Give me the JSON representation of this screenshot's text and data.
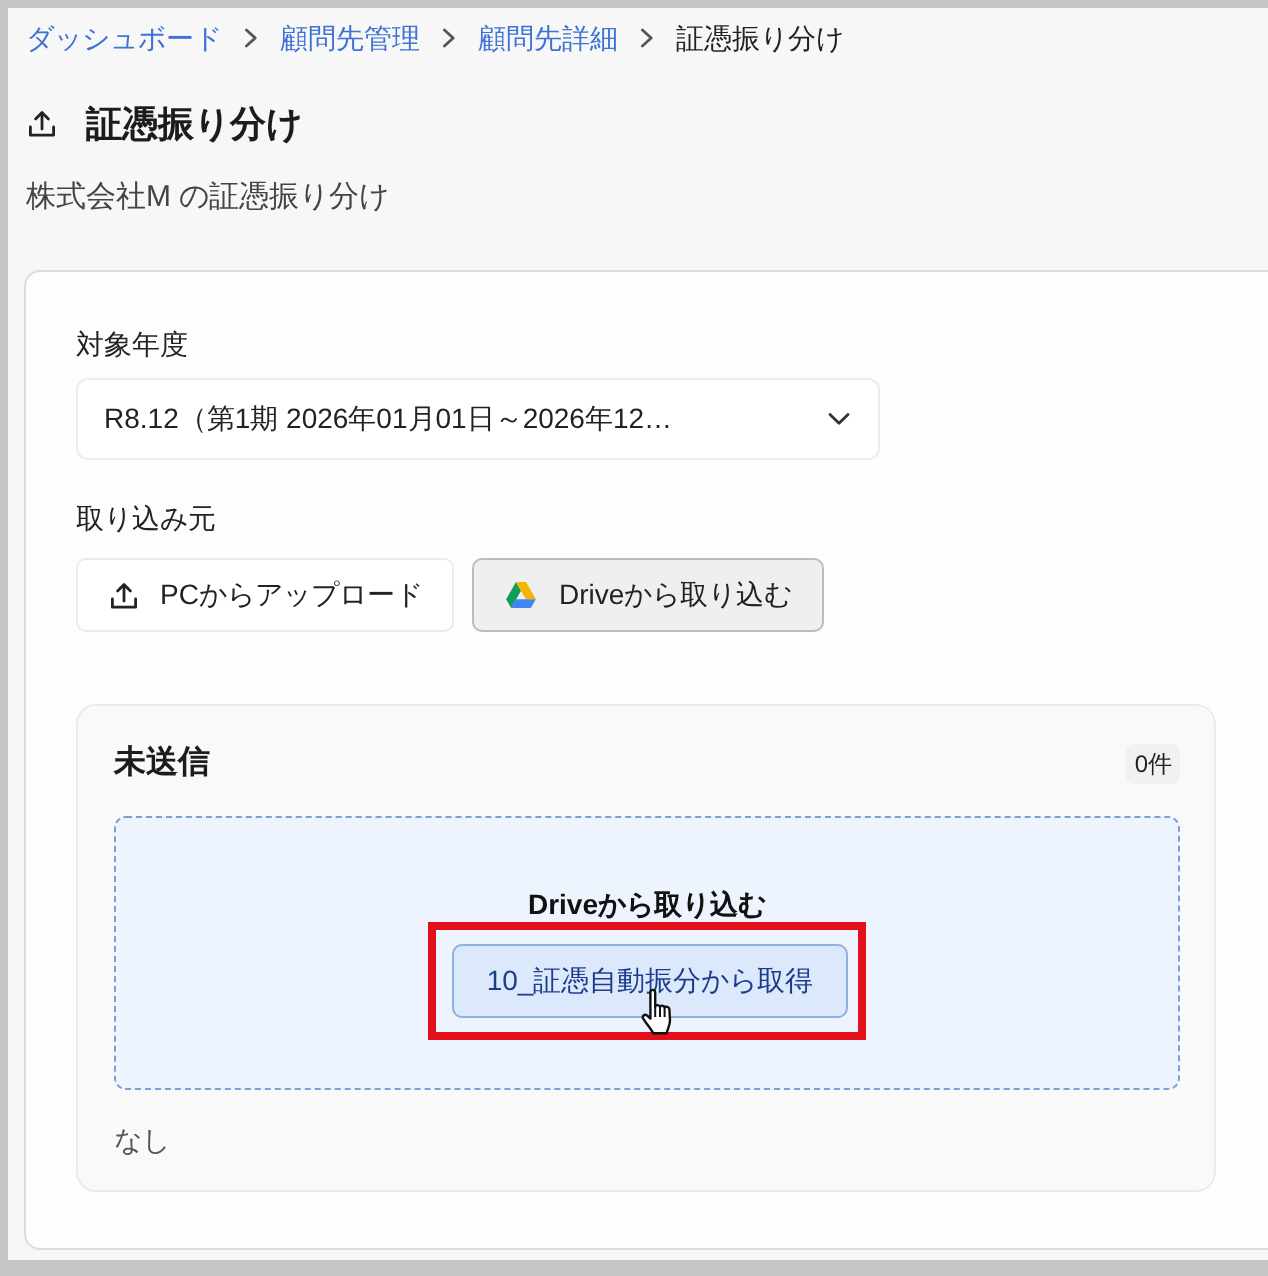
{
  "breadcrumb": [
    {
      "label": "ダッシュボード",
      "kind": "link"
    },
    {
      "label": "顧問先管理",
      "kind": "link"
    },
    {
      "label": "顧問先詳細",
      "kind": "link"
    },
    {
      "label": "証憑振り分け",
      "kind": "current"
    }
  ],
  "header": {
    "title": "証憑振り分け",
    "subtitle": "株式会社M の証憑振り分け"
  },
  "form": {
    "fiscal_year": {
      "label": "対象年度",
      "value": "R8.12（第1期 2026年01月01日～2026年12…"
    },
    "source": {
      "label": "取り込み元",
      "options": [
        {
          "label": "PCからアップロード",
          "kind": "upload",
          "selected": false
        },
        {
          "label": "Driveから取り込む",
          "kind": "drive",
          "selected": true
        }
      ]
    }
  },
  "unsent": {
    "title": "未送信",
    "count": "0件",
    "dropzone": {
      "title": "Driveから取り込む",
      "button": {
        "label": "10_証憑自動振分から取得",
        "highlighted": true,
        "hovered": true
      }
    },
    "empty_text": "なし"
  }
}
